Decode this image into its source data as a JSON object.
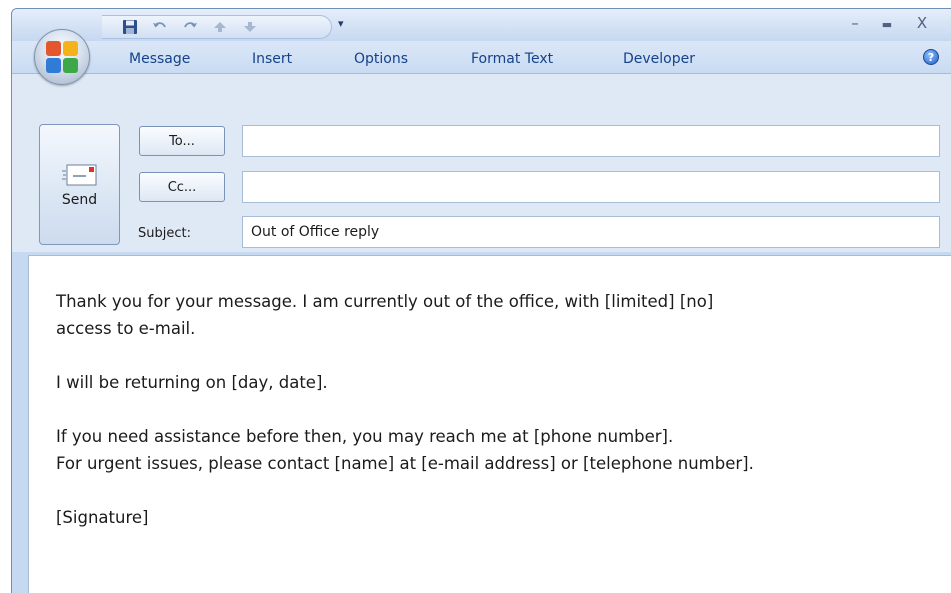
{
  "colors": {
    "accent": "#15428b",
    "window_border": "#6f8fb8",
    "ribbon_bg": "#c9dbf2",
    "header_bg": "#dfe9f6"
  },
  "title_bar": {
    "quick_access": [
      {
        "name": "save-icon"
      },
      {
        "name": "undo-icon"
      },
      {
        "name": "redo-icon"
      },
      {
        "name": "up-arrow-icon"
      },
      {
        "name": "down-arrow-icon"
      }
    ],
    "customize_glyph": "▾",
    "minimize_glyph": "–",
    "maximize_glyph": "▬",
    "close_glyph": "X"
  },
  "ribbon": {
    "tabs": [
      "Message",
      "Insert",
      "Options",
      "Format Text",
      "Developer"
    ],
    "help_glyph": "?"
  },
  "header": {
    "send_label": "Send",
    "to_button": "To...",
    "cc_button": "Cc...",
    "subject_label": "Subject:",
    "to_value": "",
    "cc_value": "",
    "subject_value": "Out of Office reply"
  },
  "message": {
    "line1": "Thank you for your message. I am currently out of the office, with [limited] [no]",
    "line2": "access to e-mail.",
    "line3": "I will be returning on [day, date].",
    "line4": "If you need assistance before then, you may reach me at [phone number].",
    "line5": "For urgent issues, please contact [name] at [e-mail address] or [telephone number].",
    "line6": "[Signature]"
  }
}
